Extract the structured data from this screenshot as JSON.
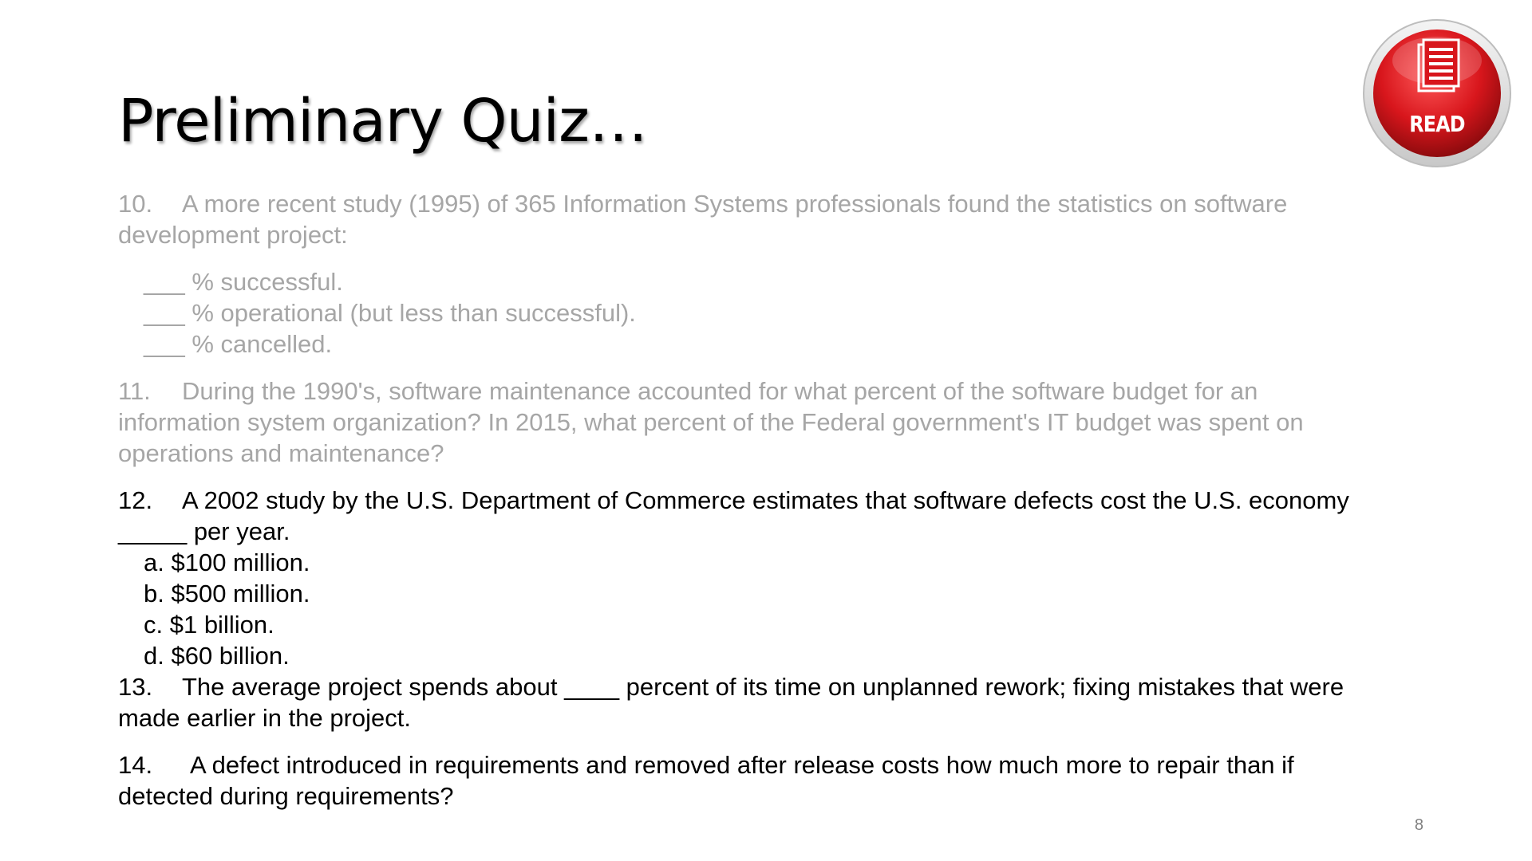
{
  "slide": {
    "title": "Preliminary Quiz…",
    "page_number": "8",
    "badge": {
      "label": "READ",
      "icon": "document-icon",
      "color": "#d8161c"
    }
  },
  "questions": [
    {
      "number": "10.",
      "text_line1": "A more recent study (1995) of 365 Information Systems professionals found the statistics on software",
      "text_line2": "development project:",
      "color": "#a6a6a6",
      "items": [
        "___ % successful.",
        "___ % operational (but less than successful).",
        "___ % cancelled."
      ]
    },
    {
      "number": "11.",
      "text_line1": "During the 1990's, software maintenance accounted for what percent of the software budget for an",
      "text_line2": "information system organization?  In 2015, what percent of the Federal government's IT budget was spent on",
      "text_line3": "operations and maintenance?",
      "color": "#a6a6a6"
    },
    {
      "number": "12.",
      "text_line1": "A 2002 study by the U.S. Department of Commerce estimates that software defects cost the U.S. economy",
      "text_line2": "_____ per year.",
      "color": "#000000",
      "options": [
        "a. $100 million.",
        "b. $500 million.",
        "c. $1 billion.",
        "d. $60 billion."
      ]
    },
    {
      "number": "13.",
      "text_line1": "The average project spends about ____ percent of its time on unplanned rework; fixing mistakes that were",
      "text_line2": "made earlier in the project.",
      "color": "#000000"
    },
    {
      "number": "14.",
      "text_line1": "A defect introduced in requirements and removed after release costs how much more to repair than if",
      "text_line2": "detected during requirements?",
      "color": "#000000"
    }
  ]
}
